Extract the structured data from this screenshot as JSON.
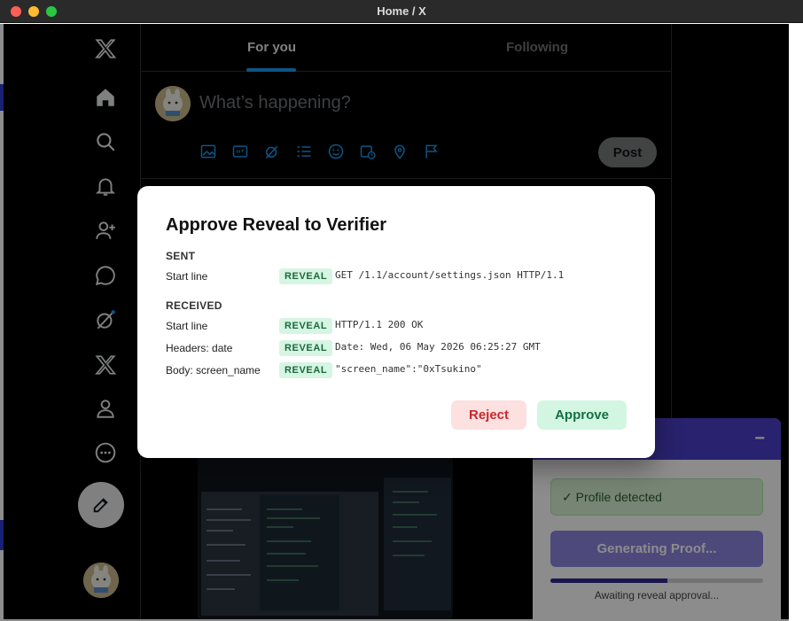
{
  "window": {
    "title": "Home / X"
  },
  "nav": {
    "items": [
      "x-logo",
      "home-icon",
      "search-icon",
      "bell-icon",
      "follow-icon",
      "messages-icon",
      "grok-icon",
      "premium-x-icon",
      "profile-icon",
      "more-icon"
    ]
  },
  "timeline": {
    "tabs": [
      {
        "label": "For you",
        "active": true
      },
      {
        "label": "Following",
        "active": false
      }
    ],
    "composer": {
      "placeholder": "What’s happening?",
      "post_label": "Post",
      "tools": [
        "media-icon",
        "gif-icon",
        "grok-icon",
        "poll-icon",
        "emoji-icon",
        "schedule-icon",
        "location-icon",
        "flag-icon"
      ]
    }
  },
  "extension": {
    "status_ok": "✓ Profile detected",
    "generate_label": "Generating Proof...",
    "progress": 0.55,
    "status_text": "Awaiting reveal approval..."
  },
  "modal": {
    "title": "Approve Reveal to Verifier",
    "sent": {
      "label": "SENT",
      "rows": [
        {
          "label": "Start line",
          "badge": "REVEAL",
          "value": "GET /1.1/account/settings.json HTTP/1.1"
        }
      ]
    },
    "received": {
      "label": "RECEIVED",
      "rows": [
        {
          "label": "Start line",
          "badge": "REVEAL",
          "value": "HTTP/1.1 200 OK"
        },
        {
          "label": "Headers: date",
          "badge": "REVEAL",
          "value": "Date: Wed, 06 May 2026 06:25:27 GMT"
        },
        {
          "label": "Body: screen_name",
          "badge": "REVEAL",
          "value": "\"screen_name\":\"0xTsukino\""
        }
      ]
    },
    "reject_label": "Reject",
    "approve_label": "Approve"
  },
  "colors": {
    "accent": "#1d9bf0",
    "extension_brand": "#4c3ec9",
    "approve": "#14703f",
    "reject": "#c6282b"
  }
}
